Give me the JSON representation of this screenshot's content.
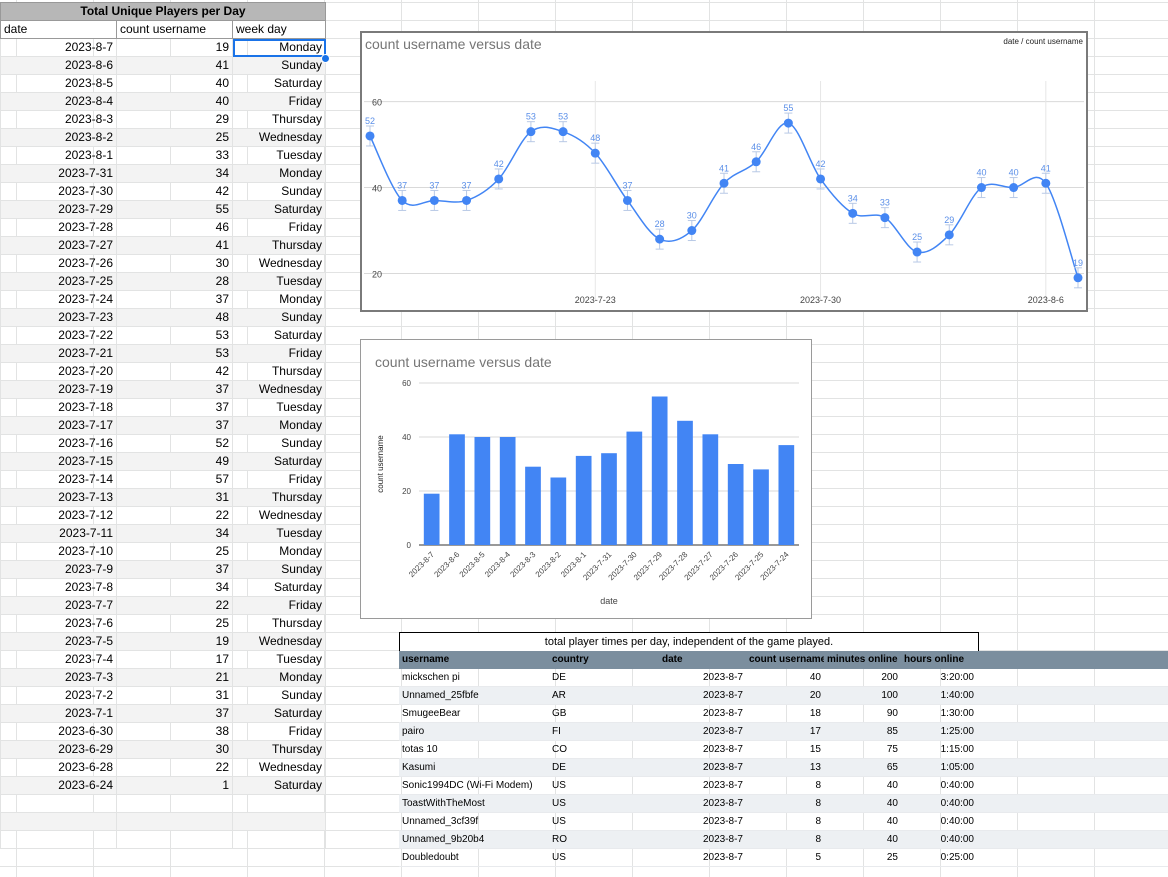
{
  "left_table": {
    "title": "Total Unique Players per Day",
    "headers": [
      "date",
      "count username",
      "week day"
    ],
    "rows": [
      [
        "2023-8-7",
        "19",
        "Monday"
      ],
      [
        "2023-8-6",
        "41",
        "Sunday"
      ],
      [
        "2023-8-5",
        "40",
        "Saturday"
      ],
      [
        "2023-8-4",
        "40",
        "Friday"
      ],
      [
        "2023-8-3",
        "29",
        "Thursday"
      ],
      [
        "2023-8-2",
        "25",
        "Wednesday"
      ],
      [
        "2023-8-1",
        "33",
        "Tuesday"
      ],
      [
        "2023-7-31",
        "34",
        "Monday"
      ],
      [
        "2023-7-30",
        "42",
        "Sunday"
      ],
      [
        "2023-7-29",
        "55",
        "Saturday"
      ],
      [
        "2023-7-28",
        "46",
        "Friday"
      ],
      [
        "2023-7-27",
        "41",
        "Thursday"
      ],
      [
        "2023-7-26",
        "30",
        "Wednesday"
      ],
      [
        "2023-7-25",
        "28",
        "Tuesday"
      ],
      [
        "2023-7-24",
        "37",
        "Monday"
      ],
      [
        "2023-7-23",
        "48",
        "Sunday"
      ],
      [
        "2023-7-22",
        "53",
        "Saturday"
      ],
      [
        "2023-7-21",
        "53",
        "Friday"
      ],
      [
        "2023-7-20",
        "42",
        "Thursday"
      ],
      [
        "2023-7-19",
        "37",
        "Wednesday"
      ],
      [
        "2023-7-18",
        "37",
        "Tuesday"
      ],
      [
        "2023-7-17",
        "37",
        "Monday"
      ],
      [
        "2023-7-16",
        "52",
        "Sunday"
      ],
      [
        "2023-7-15",
        "49",
        "Saturday"
      ],
      [
        "2023-7-14",
        "57",
        "Friday"
      ],
      [
        "2023-7-13",
        "31",
        "Thursday"
      ],
      [
        "2023-7-12",
        "22",
        "Wednesday"
      ],
      [
        "2023-7-11",
        "34",
        "Tuesday"
      ],
      [
        "2023-7-10",
        "25",
        "Monday"
      ],
      [
        "2023-7-9",
        "37",
        "Sunday"
      ],
      [
        "2023-7-8",
        "34",
        "Saturday"
      ],
      [
        "2023-7-7",
        "22",
        "Friday"
      ],
      [
        "2023-7-6",
        "25",
        "Thursday"
      ],
      [
        "2023-7-5",
        "19",
        "Wednesday"
      ],
      [
        "2023-7-4",
        "17",
        "Tuesday"
      ],
      [
        "2023-7-3",
        "21",
        "Monday"
      ],
      [
        "2023-7-2",
        "31",
        "Sunday"
      ],
      [
        "2023-7-1",
        "37",
        "Saturday"
      ],
      [
        "2023-6-30",
        "38",
        "Friday"
      ],
      [
        "2023-6-29",
        "30",
        "Thursday"
      ],
      [
        "2023-6-28",
        "22",
        "Wednesday"
      ],
      [
        "2023-6-24",
        "1",
        "Saturday"
      ]
    ]
  },
  "chart_data": [
    {
      "type": "line",
      "title": "count username versus date",
      "legend": "date / count username",
      "legend_position": "top-right",
      "x": [
        "2023-7-16",
        "2023-7-17",
        "2023-7-18",
        "2023-7-19",
        "2023-7-20",
        "2023-7-21",
        "2023-7-22",
        "2023-7-23",
        "2023-7-24",
        "2023-7-25",
        "2023-7-26",
        "2023-7-27",
        "2023-7-28",
        "2023-7-29",
        "2023-7-30",
        "2023-7-31",
        "2023-8-1",
        "2023-8-2",
        "2023-8-3",
        "2023-8-4",
        "2023-8-5",
        "2023-8-6",
        "2023-8-7"
      ],
      "values": [
        52,
        37,
        37,
        37,
        42,
        53,
        53,
        48,
        37,
        28,
        30,
        41,
        46,
        55,
        42,
        34,
        33,
        25,
        29,
        40,
        40,
        41,
        19
      ],
      "x_ticks": [
        "2023-7-23",
        "2023-7-30",
        "2023-8-6"
      ],
      "y_ticks": [
        20,
        40,
        60
      ],
      "ylim": [
        15,
        62
      ],
      "grid": true,
      "color": "#4285f4"
    },
    {
      "type": "bar",
      "title": "count username versus date",
      "xlabel": "date",
      "ylabel": "count username",
      "categories": [
        "2023-8-7",
        "2023-8-6",
        "2023-8-5",
        "2023-8-4",
        "2023-8-3",
        "2023-8-2",
        "2023-8-1",
        "2023-7-31",
        "2023-7-30",
        "2023-7-29",
        "2023-7-28",
        "2023-7-27",
        "2023-7-26",
        "2023-7-25",
        "2023-7-24"
      ],
      "values": [
        19,
        41,
        40,
        40,
        29,
        25,
        33,
        34,
        42,
        55,
        46,
        41,
        30,
        28,
        37
      ],
      "y_ticks": [
        0,
        20,
        40,
        60
      ],
      "ylim": [
        0,
        60
      ],
      "grid": true,
      "color": "#4285f4"
    }
  ],
  "bottom_table": {
    "title": "total player times per day, independent of the game played.",
    "headers": [
      "username",
      "country",
      "date",
      "count username",
      "minutes online",
      "hours online"
    ],
    "rows": [
      [
        "mickschen pi",
        "DE",
        "2023-8-7",
        "40",
        "200",
        "3:20:00"
      ],
      [
        "Unnamed_25fbfe",
        "AR",
        "2023-8-7",
        "20",
        "100",
        "1:40:00"
      ],
      [
        "SmugeeBear",
        "GB",
        "2023-8-7",
        "18",
        "90",
        "1:30:00"
      ],
      [
        "pairo",
        "FI",
        "2023-8-7",
        "17",
        "85",
        "1:25:00"
      ],
      [
        "totas 10",
        "CO",
        "2023-8-7",
        "15",
        "75",
        "1:15:00"
      ],
      [
        "Kasumi",
        "DE",
        "2023-8-7",
        "13",
        "65",
        "1:05:00"
      ],
      [
        "Sonic1994DC (Wi-Fi Modem)",
        "US",
        "2023-8-7",
        "8",
        "40",
        "0:40:00"
      ],
      [
        "ToastWithTheMost",
        "US",
        "2023-8-7",
        "8",
        "40",
        "0:40:00"
      ],
      [
        "Unnamed_3cf39f",
        "US",
        "2023-8-7",
        "8",
        "40",
        "0:40:00"
      ],
      [
        "Unnamed_9b20b4",
        "RO",
        "2023-8-7",
        "8",
        "40",
        "0:40:00"
      ],
      [
        "Doubledoubt",
        "US",
        "2023-8-7",
        "5",
        "25",
        "0:25:00"
      ]
    ]
  }
}
